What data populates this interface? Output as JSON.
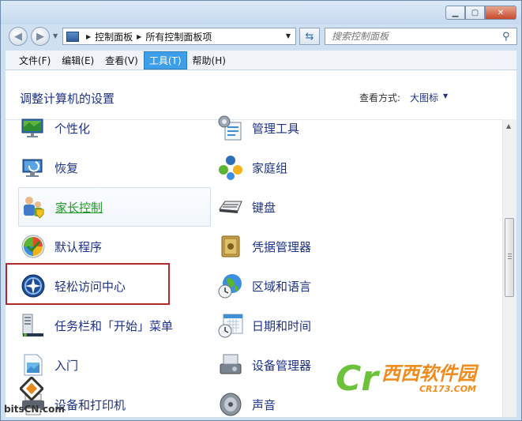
{
  "titlebar": {
    "minimize": "▁",
    "maximize": "▢",
    "close": "✕"
  },
  "address": {
    "crumbs": [
      "控制面板",
      "所有控制面板项"
    ],
    "search_placeholder": "搜索控制面板"
  },
  "menu": [
    "文件(F)",
    "编辑(E)",
    "查看(V)",
    "工具(T)",
    "帮助(H)"
  ],
  "active_menu_index": 3,
  "content": {
    "title": "调整计算机的设置",
    "view_label": "查看方式:",
    "view_value": "大图标"
  },
  "items_left": [
    {
      "label": "个性化",
      "icon": "personalization-icon"
    },
    {
      "label": "恢复",
      "icon": "recovery-icon"
    },
    {
      "label": "家长控制",
      "icon": "parental-controls-icon"
    },
    {
      "label": "默认程序",
      "icon": "default-programs-icon"
    },
    {
      "label": "轻松访问中心",
      "icon": "ease-of-access-icon"
    },
    {
      "label": "任务栏和「开始」菜单",
      "icon": "taskbar-icon"
    },
    {
      "label": "入门",
      "icon": "getting-started-icon"
    },
    {
      "label": "设备和打印机",
      "icon": "devices-printers-icon"
    }
  ],
  "items_right": [
    {
      "label": "管理工具",
      "icon": "admin-tools-icon"
    },
    {
      "label": "家庭组",
      "icon": "homegroup-icon"
    },
    {
      "label": "键盘",
      "icon": "keyboard-icon"
    },
    {
      "label": "凭据管理器",
      "icon": "credential-manager-icon"
    },
    {
      "label": "区域和语言",
      "icon": "region-language-icon"
    },
    {
      "label": "日期和时间",
      "icon": "date-time-icon"
    },
    {
      "label": "设备管理器",
      "icon": "device-manager-icon"
    },
    {
      "label": "声音",
      "icon": "sound-icon"
    }
  ],
  "watermarks": {
    "cr_big": "西西软件园",
    "cr_small": "CR173.COM",
    "bits": "bitsCN.com"
  }
}
